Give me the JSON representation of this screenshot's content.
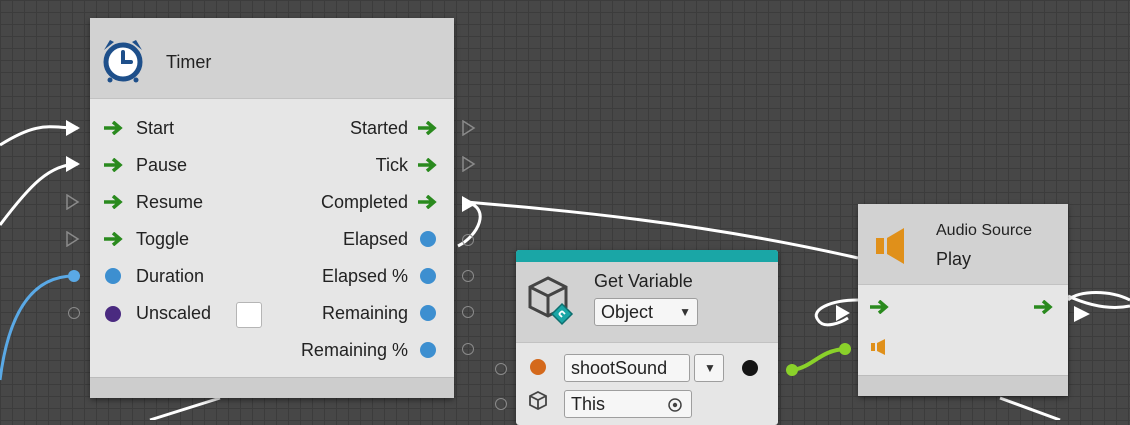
{
  "timer_node": {
    "title": "Timer",
    "icon": "alarm-clock-icon",
    "inputs": [
      {
        "label": "Start",
        "kind": "flow"
      },
      {
        "label": "Pause",
        "kind": "flow"
      },
      {
        "label": "Resume",
        "kind": "flow"
      },
      {
        "label": "Toggle",
        "kind": "flow"
      },
      {
        "label": "Duration",
        "kind": "value"
      },
      {
        "label": "Unscaled",
        "kind": "value",
        "checkbox": false
      }
    ],
    "outputs": [
      {
        "label": "Started",
        "kind": "flow"
      },
      {
        "label": "Tick",
        "kind": "flow"
      },
      {
        "label": "Completed",
        "kind": "flow"
      },
      {
        "label": "Elapsed",
        "kind": "value"
      },
      {
        "label": "Elapsed %",
        "kind": "value"
      },
      {
        "label": "Remaining",
        "kind": "value"
      },
      {
        "label": "Remaining %",
        "kind": "value"
      }
    ]
  },
  "get_variable_node": {
    "title": "Get Variable",
    "kind_dropdown": "Object",
    "variable_name": "shootSound",
    "target": "This",
    "accent_color": "#1aa6a6"
  },
  "audio_node": {
    "subtitle": "Audio Source",
    "title": "Play",
    "icon": "speaker-icon"
  },
  "colors": {
    "flow_arrow": "#2a8a1e",
    "float_port": "#3d8fd0",
    "bool_port": "#4a2a80",
    "object_port": "#d4691c",
    "audio_port": "#e0901a",
    "wire_white": "#ffffff",
    "wire_blue": "#5aa9e6",
    "wire_green": "#8ad12a"
  }
}
